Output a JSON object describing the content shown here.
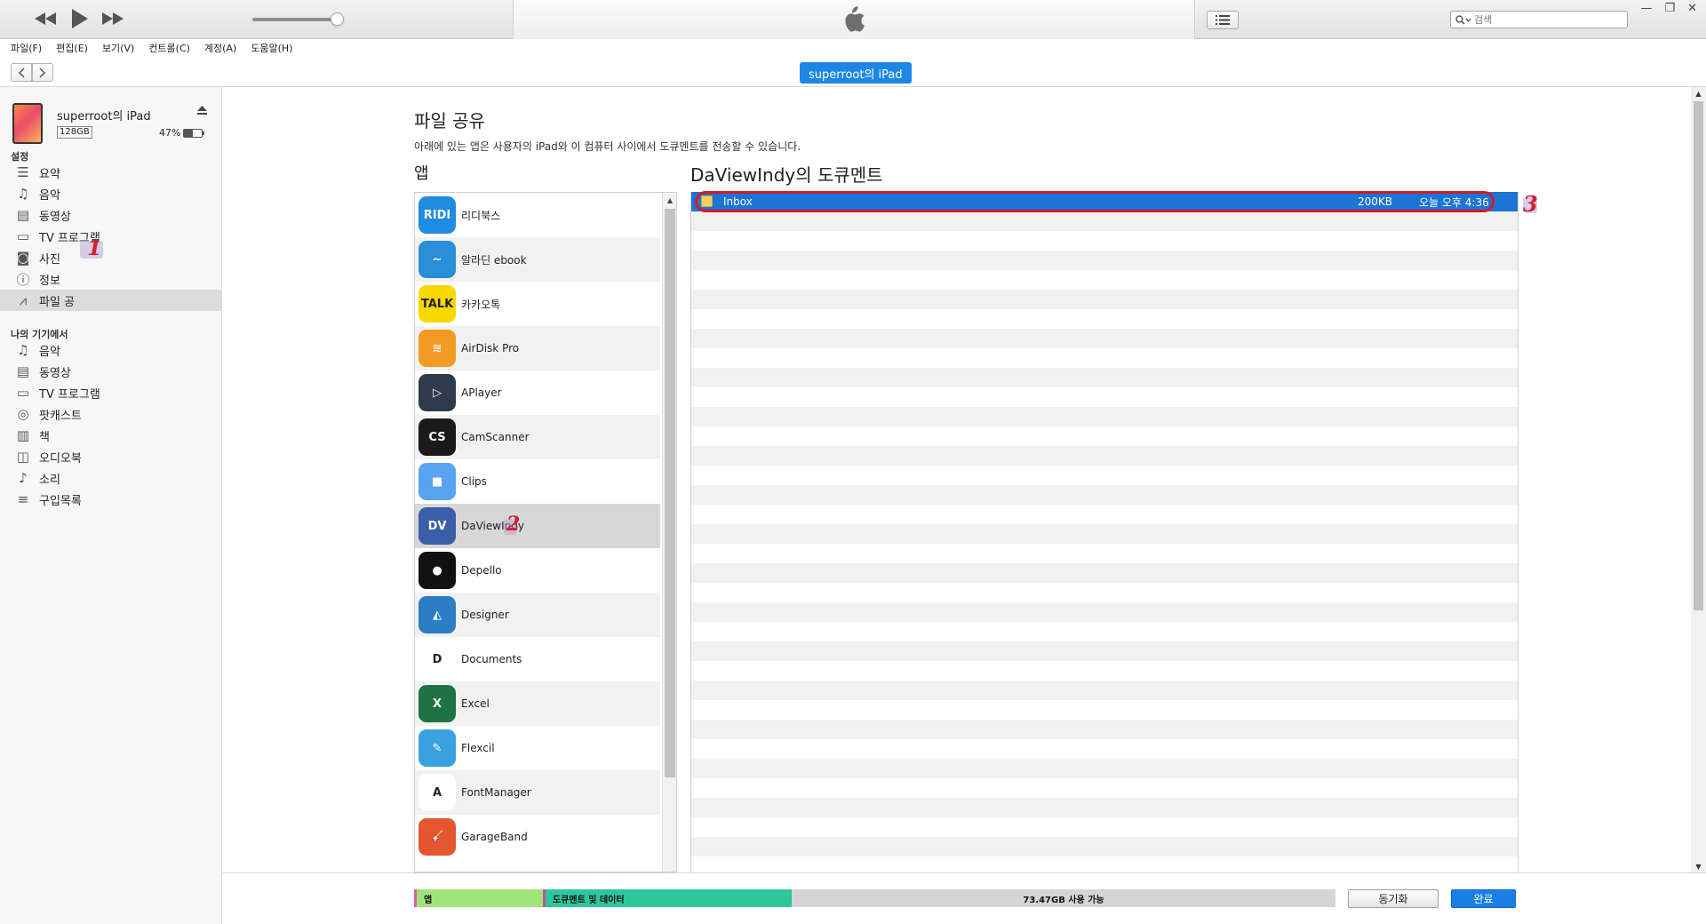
{
  "window": {
    "title_logo": "apple-logo",
    "search_placeholder": "검색",
    "controls": [
      "—",
      "❐",
      "✕"
    ]
  },
  "menu": [
    "파일(F)",
    "편집(E)",
    "보기(V)",
    "컨트롤(C)",
    "계정(A)",
    "도움말(H)"
  ],
  "nav": {
    "device_pill": "superroot의 iPad"
  },
  "device": {
    "name": "superroot의 iPad",
    "capacity": "128GB",
    "battery": "47%",
    "battery_level": 0.47
  },
  "sidebar": {
    "settings_heading": "설정",
    "settings_items": [
      {
        "label": "요약",
        "icon": "summary-icon"
      },
      {
        "label": "음악",
        "icon": "music-icon"
      },
      {
        "label": "동영상",
        "icon": "movie-icon"
      },
      {
        "label": "TV 프로그램",
        "icon": "tv-icon"
      },
      {
        "label": "사진",
        "icon": "camera-icon"
      },
      {
        "label": "정보",
        "icon": "info-icon"
      },
      {
        "label": "파일 공",
        "icon": "app-store-icon",
        "selected": true
      }
    ],
    "device_heading": "나의 기기에서",
    "device_items": [
      {
        "label": "음악",
        "icon": "music-icon"
      },
      {
        "label": "동영상",
        "icon": "movie-icon"
      },
      {
        "label": "TV 프로그램",
        "icon": "tv-icon"
      },
      {
        "label": "팟캐스트",
        "icon": "podcast-icon"
      },
      {
        "label": "책",
        "icon": "book-icon"
      },
      {
        "label": "오디오북",
        "icon": "audiobook-icon"
      },
      {
        "label": "소리",
        "icon": "bell-icon"
      },
      {
        "label": "구입목록",
        "icon": "purchased-list-icon"
      }
    ]
  },
  "annotations": {
    "step1": "1",
    "step2": "2",
    "step3": "3"
  },
  "main": {
    "title": "파일 공유",
    "description": "아래에 있는 앱은 사용자의 iPad와 이 컴퓨터 사이에서 도큐멘트를 전송할 수 있습니다.",
    "apps_heading": "앱",
    "docs_heading": "DaViewIndy의 도큐멘트",
    "apps": [
      {
        "name": "리디북스",
        "icon_text": "RIDI",
        "color": "#1e8ce0"
      },
      {
        "name": "알라딘 ebook",
        "icon_text": "~",
        "color": "#2a8fd8"
      },
      {
        "name": "카카오톡",
        "icon_text": "TALK",
        "color": "#f7d800"
      },
      {
        "name": "AirDisk Pro",
        "icon_text": "≋",
        "color": "#f39a24"
      },
      {
        "name": "APlayer",
        "icon_text": "▷",
        "color": "#2f3a4a"
      },
      {
        "name": "CamScanner",
        "icon_text": "CS",
        "color": "#1a1a1a"
      },
      {
        "name": "Clips",
        "icon_text": "■",
        "color": "#5aa3f0"
      },
      {
        "name": "DaViewIndy",
        "icon_text": "DV",
        "color": "#3a5fa8",
        "selected": true
      },
      {
        "name": "Depello",
        "icon_text": "●",
        "color": "#111111"
      },
      {
        "name": "Designer",
        "icon_text": "◭",
        "color": "#2a7fc4"
      },
      {
        "name": "Documents",
        "icon_text": "D",
        "color": "#ffffff"
      },
      {
        "name": "Excel",
        "icon_text": "X",
        "color": "#1f7244"
      },
      {
        "name": "Flexcil",
        "icon_text": "✎",
        "color": "#3aa0e0"
      },
      {
        "name": "FontManager",
        "icon_text": "A",
        "color": "#ffffff"
      },
      {
        "name": "GarageBand",
        "icon_text": "🎸",
        "color": "#e4572e"
      }
    ],
    "documents": [
      {
        "name": "Inbox",
        "size": "200KB",
        "date": "오늘 오후 4:36"
      }
    ]
  },
  "bottom": {
    "seg_apps": "앱",
    "seg_docs": "도큐멘트 및 데이터",
    "seg_free": "73.47GB 사용 가능",
    "sync_label": "동기화",
    "done_label": "완료"
  }
}
